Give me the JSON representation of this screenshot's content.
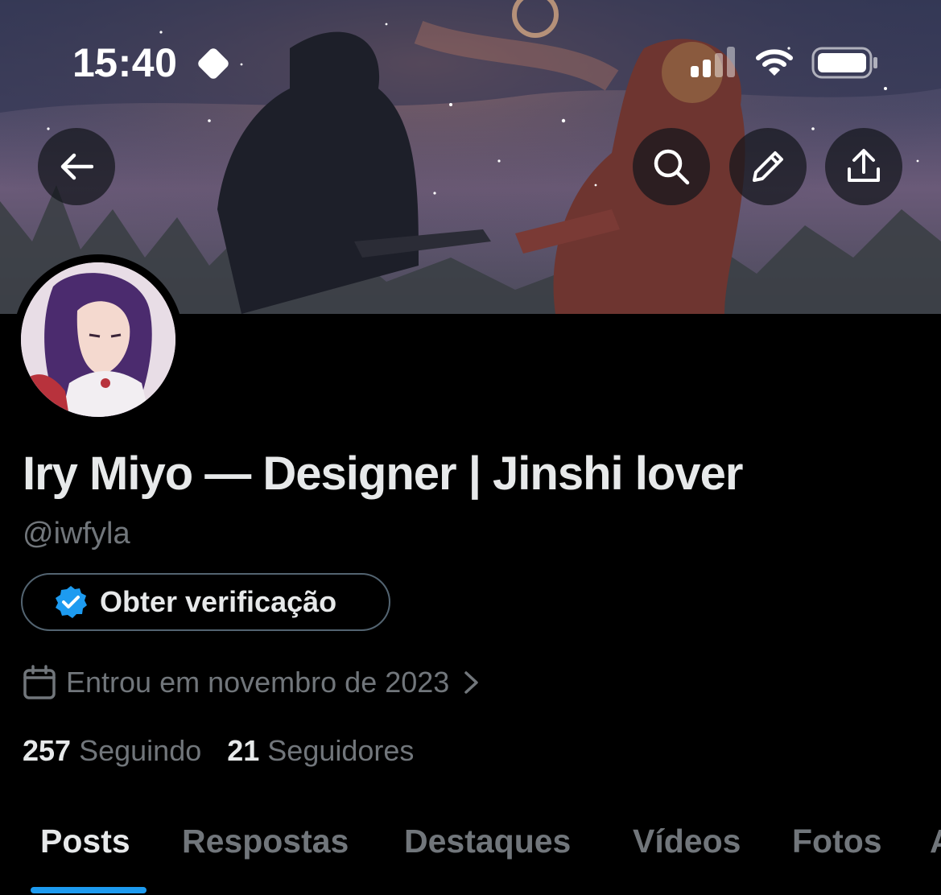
{
  "status_bar": {
    "time": "15:40",
    "icons": [
      "diamond-icon",
      "signal-icon",
      "wifi-icon",
      "battery-icon"
    ]
  },
  "header": {
    "buttons": [
      "back-arrow-icon",
      "search-icon",
      "edit-pencil-icon",
      "share-upload-icon"
    ]
  },
  "profile": {
    "display_name": "Iry Miyo — Designer | Jinshi lover",
    "handle": "@iwfyla",
    "verify_button_label": "Obter verificação",
    "joined_text": "Entrou em novembro de 2023",
    "following_count": "257",
    "following_label": "Seguindo",
    "followers_count": "21",
    "followers_label": "Seguidores"
  },
  "tabs": [
    {
      "label": "Posts",
      "active": true
    },
    {
      "label": "Respostas",
      "active": false
    },
    {
      "label": "Destaques",
      "active": false
    },
    {
      "label": "Vídeos",
      "active": false
    },
    {
      "label": "Fotos",
      "active": false
    },
    {
      "label": "Artigos",
      "active": false
    }
  ],
  "colors": {
    "background": "#000000",
    "primary_text": "#e7e9ea",
    "secondary_text": "#71767b",
    "accent": "#1d9bf0",
    "border": "#536471"
  }
}
